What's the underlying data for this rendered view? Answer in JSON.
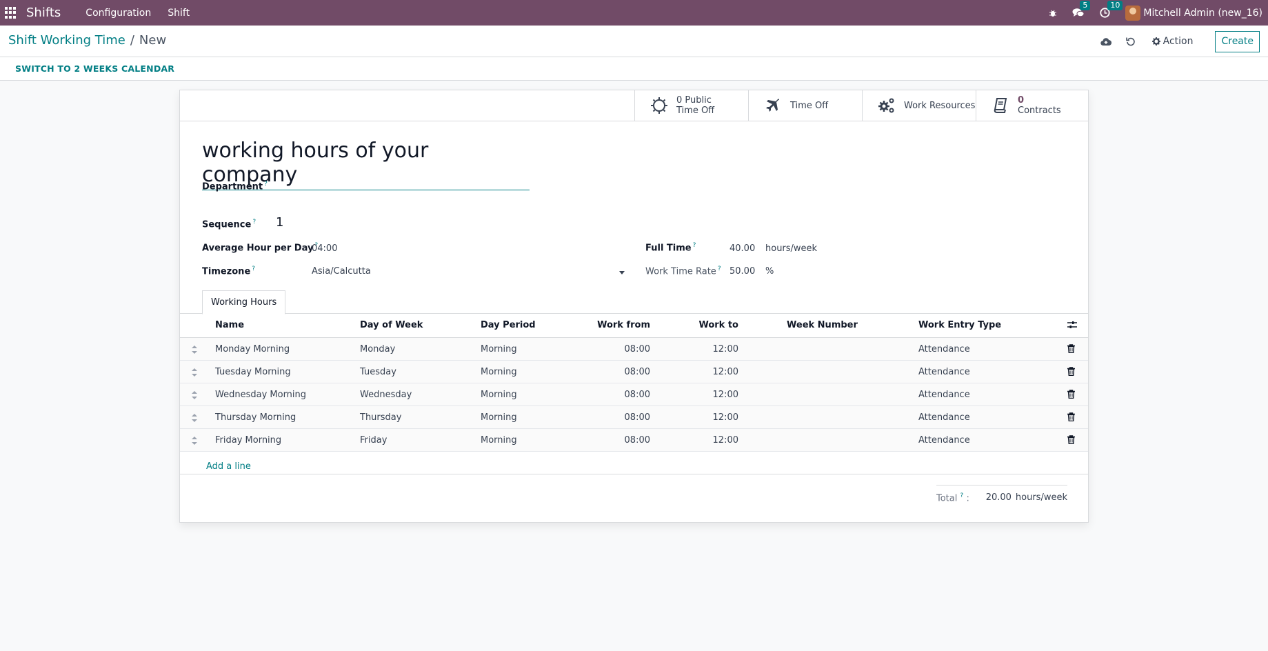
{
  "navbar": {
    "app_name": "Shifts",
    "menu": [
      "Configuration",
      "Shift"
    ],
    "messages_badge": "5",
    "activities_badge": "10",
    "user": "Mitchell Admin (new_16)"
  },
  "breadcrumb": {
    "parent": "Shift Working Time",
    "separator": "/",
    "current": "New"
  },
  "control": {
    "action_label": "Action",
    "create_label": "Create"
  },
  "statusbar": {
    "switch_label": "SWITCH TO 2 WEEKS CALENDAR"
  },
  "stat_buttons": {
    "public_time_off": {
      "line1": "0 Public",
      "line2": "Time Off"
    },
    "time_off": {
      "label": "Time Off"
    },
    "work_resources": {
      "label": "Work Resources"
    },
    "contracts": {
      "count": "0",
      "label": "Contracts"
    }
  },
  "form": {
    "name": "working hours of your company",
    "department_label": "Department",
    "sequence_label": "Sequence",
    "sequence_value": "1",
    "avg_hour_label": "Average Hour per Day",
    "avg_hour_value": "04:00",
    "timezone_label": "Timezone",
    "timezone_value": "Asia/Calcutta",
    "full_time_label": "Full Time",
    "full_time_value": "40.00",
    "full_time_unit": "hours/week",
    "work_rate_label": "Work Time Rate",
    "work_rate_value": "50.00",
    "work_rate_unit": "%",
    "help_mark": "?"
  },
  "tabs": {
    "working_hours": "Working Hours"
  },
  "table": {
    "headers": {
      "name": "Name",
      "day": "Day of Week",
      "period": "Day Period",
      "from": "Work from",
      "to": "Work to",
      "week": "Week Number",
      "entry": "Work Entry Type"
    },
    "rows": [
      {
        "name": "Monday Morning",
        "day": "Monday",
        "period": "Morning",
        "from": "08:00",
        "to": "12:00",
        "entry": "Attendance"
      },
      {
        "name": "Tuesday Morning",
        "day": "Tuesday",
        "period": "Morning",
        "from": "08:00",
        "to": "12:00",
        "entry": "Attendance"
      },
      {
        "name": "Wednesday Morning",
        "day": "Wednesday",
        "period": "Morning",
        "from": "08:00",
        "to": "12:00",
        "entry": "Attendance"
      },
      {
        "name": "Thursday Morning",
        "day": "Thursday",
        "period": "Morning",
        "from": "08:00",
        "to": "12:00",
        "entry": "Attendance"
      },
      {
        "name": "Friday Morning",
        "day": "Friday",
        "period": "Morning",
        "from": "08:00",
        "to": "12:00",
        "entry": "Attendance"
      }
    ],
    "add_line": "Add a line"
  },
  "total": {
    "label": "Total",
    "colon": ":",
    "value": "20.00",
    "unit": "hours/week"
  },
  "colors": {
    "brand": "#714b67",
    "accent": "#017e84"
  }
}
